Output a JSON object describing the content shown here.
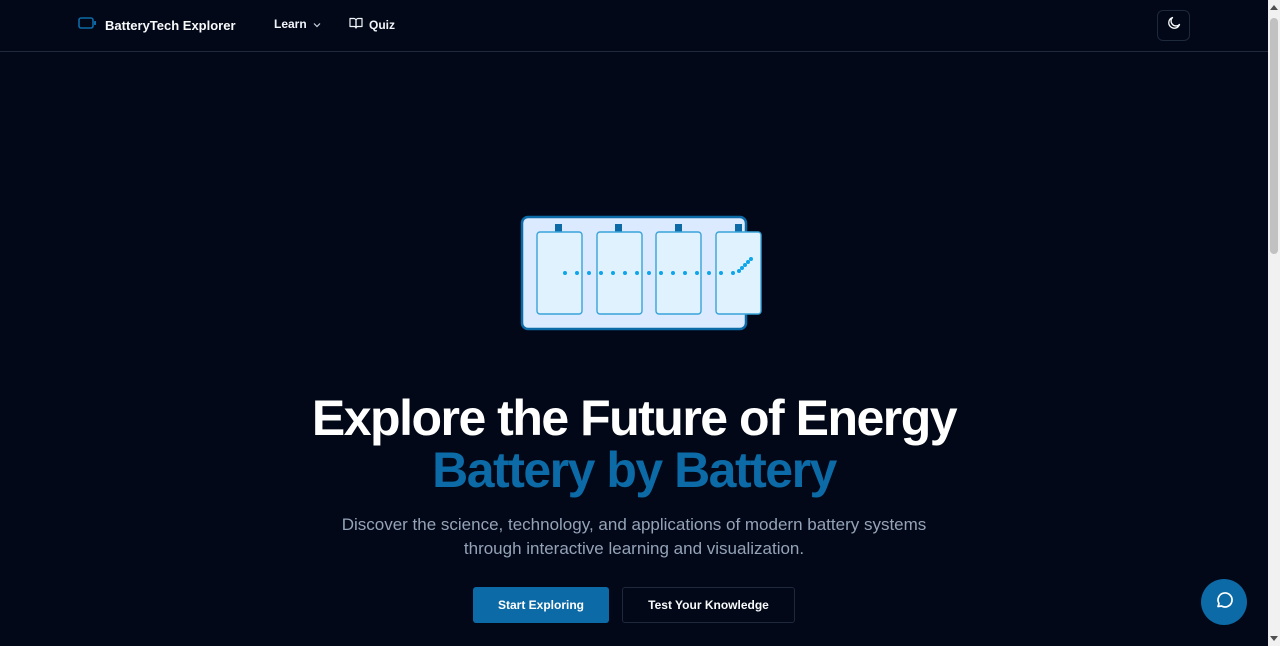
{
  "nav": {
    "brand": "BatteryTech Explorer",
    "brand_icon": "battery-icon",
    "learn_label": "Learn",
    "quiz_label": "Quiz",
    "quiz_icon": "book-open-icon",
    "theme_icon": "moon-icon"
  },
  "hero": {
    "title_line1": "Explore the Future of Energy",
    "title_line2": "Battery by Battery",
    "subtitle": "Discover the science, technology, and applications of modern battery systems through interactive learning and visualization.",
    "primary_cta": "Start Exploring",
    "secondary_cta": "Test Your Knowledge"
  },
  "chat": {
    "icon": "message-circle-icon"
  },
  "colors": {
    "background": "#020817",
    "accent": "#0c6aa6",
    "border": "#1e293b",
    "muted_text": "#94a3b8"
  }
}
